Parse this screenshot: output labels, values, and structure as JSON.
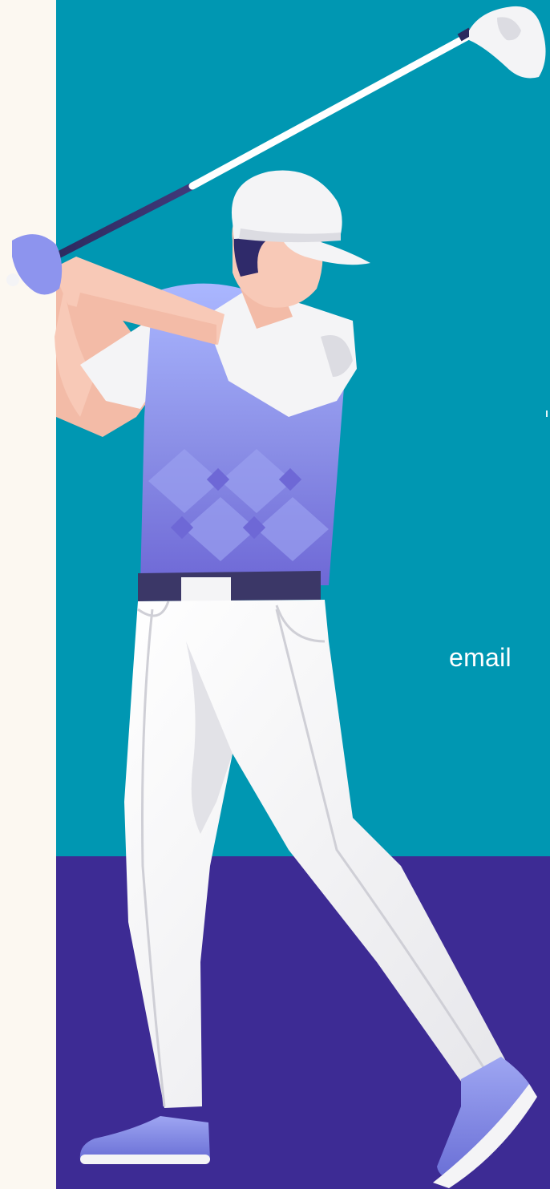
{
  "page": {
    "email_partial_text": "email"
  },
  "illustration": {
    "subject": "golfer-swinging-club",
    "colors": {
      "teal_background": "#0097b2",
      "purple_background": "#3d2b94",
      "cream_background": "#fcf8f1",
      "vest": "#8a8ee6",
      "pants": "#f4f4f6",
      "shoes": "#7a80de",
      "skin": "#f8c9b7",
      "cap": "#f5f5f5",
      "belt": "#3b3767"
    }
  }
}
